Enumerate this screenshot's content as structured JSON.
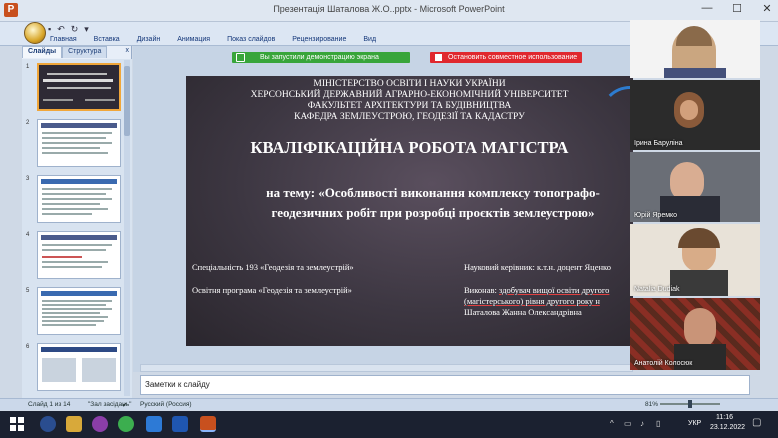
{
  "window": {
    "title": "Презентація Шаталова Ж.О..pptx - Microsoft PowerPoint",
    "app_icon": "P",
    "controls": [
      "—",
      "☐",
      "✕"
    ]
  },
  "ribbon": {
    "tabs": [
      "Главная",
      "Вставка",
      "Дизайн",
      "Анимация",
      "Показ слайдов",
      "Рецензирование",
      "Вид"
    ]
  },
  "banners": {
    "demo": "Вы запустили демонстрацию экрана",
    "stop": "Остановить совместное использование"
  },
  "left_pane": {
    "tabs": [
      "Слайды",
      "Структура"
    ],
    "close": "x",
    "slide_numbers": [
      "1",
      "2",
      "3",
      "4",
      "5",
      "6"
    ]
  },
  "slide": {
    "line1": "МІНІСТЕРСТВО ОСВІТИ І НАУКИ УКРАЇНИ",
    "line2": "ХЕРСОНСЬКИЙ ДЕРЖАВНИЙ АГРАРНО-ЕКОНОМІЧНИЙ УНІВЕРСИТЕТ",
    "line3": "ФАКУЛЬТЕТ АРХІТЕКТУРИ ТА БУДІВНИЦТВА",
    "line4": "КАФЕДРА ЗЕМЛЕУСТРОЮ, ГЕОДЕЗІЇ ТА КАДАСТРУ",
    "title": "КВАЛІФІКАЦІЙНА РОБОТА МАГІСТРА",
    "theme1": "на тему: «Особливості виконання комплексу топографо-",
    "theme2": "геодезичних робіт при розробці проєктів землеустрою»",
    "specialty": "Спеціальність 193  «Геодезія та землеустрій»",
    "program": "Освітня програма «Геодезія та землеустрій»",
    "supervisor": "Науковий керівник: к.т.н. доцент Яценко",
    "performer_label": "Виконав:",
    "performer_line1": "здобувач вищої освіти другого",
    "performer_line2": "(магістерського) рівня другого року н",
    "performer_line3": "Шаталова Жанна Олександрівна"
  },
  "notes": {
    "placeholder": "Заметки к слайду"
  },
  "status": {
    "slide_info": "Слайд 1 из 14",
    "theme": "\"Зал засідань\"",
    "language": "Русский (Россия)",
    "zoom": "81%"
  },
  "taskbar": {
    "language": "УКР",
    "time": "11:16",
    "date": "23.12.2022"
  },
  "participants": [
    {
      "name": ""
    },
    {
      "name": "Ірина Баруліна"
    },
    {
      "name": "Юрій Яремко"
    },
    {
      "name": "Natalia Dudiak"
    },
    {
      "name": "Анатолій Колосюк"
    }
  ],
  "colors": {
    "demo_banner": "#38a53a",
    "stop_banner": "#e0282e",
    "slide_bg": "#3d3742",
    "taskbar": "#1b2130"
  }
}
